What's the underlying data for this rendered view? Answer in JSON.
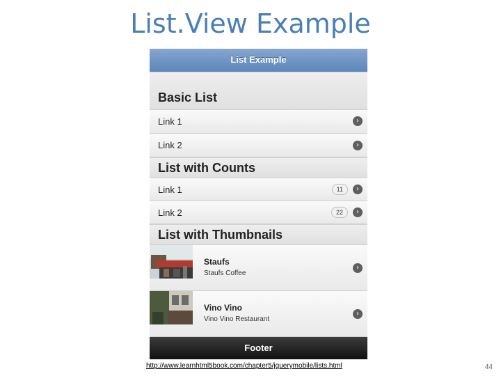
{
  "slide": {
    "title": "List.View Example",
    "url": "http://www.learnhtml5book.com/chapter5/jquerymobile/lists.html",
    "page_number": "44"
  },
  "app": {
    "header_title": "List Example",
    "footer_title": "Footer",
    "sections": [
      {
        "title": "Basic List",
        "items": [
          {
            "label": "Link 1",
            "icon": "arrow-right-icon"
          },
          {
            "label": "Link 2",
            "icon": "arrow-right-icon"
          }
        ]
      },
      {
        "title": "List with Counts",
        "items": [
          {
            "label": "Link 1",
            "count": "11",
            "icon": "arrow-right-icon"
          },
          {
            "label": "Link 2",
            "count": "22",
            "icon": "arrow-right-icon"
          }
        ]
      },
      {
        "title": "List with Thumbnails",
        "items": [
          {
            "title": "Staufs",
            "subtitle": "Staufs Coffee",
            "icon": "arrow-right-icon"
          },
          {
            "title": "Vino Vino",
            "subtitle": "Vino Vino Restaurant",
            "icon": "arrow-right-icon"
          }
        ]
      }
    ]
  },
  "colors": {
    "title": "#4a7fb5",
    "header": "#5c86ba",
    "footer": "#1a1a1a"
  }
}
